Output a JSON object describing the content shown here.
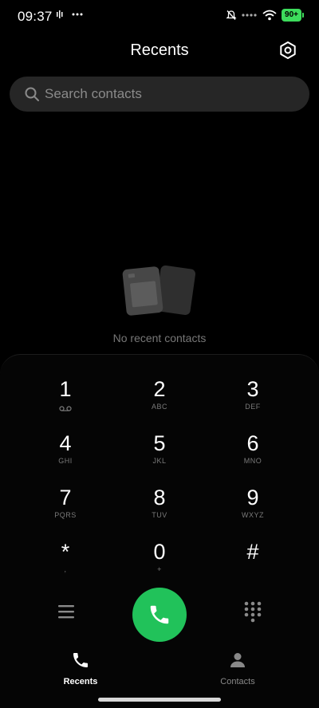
{
  "status_bar": {
    "time": "09:37",
    "battery": "90+"
  },
  "header": {
    "title": "Recents",
    "settings_icon": "settings-icon"
  },
  "search": {
    "placeholder": "Search contacts"
  },
  "empty_state": {
    "message": "No recent contacts"
  },
  "dialpad": {
    "keys": [
      {
        "digit": "1",
        "letters": ""
      },
      {
        "digit": "2",
        "letters": "ABC"
      },
      {
        "digit": "3",
        "letters": "DEF"
      },
      {
        "digit": "4",
        "letters": "GHI"
      },
      {
        "digit": "5",
        "letters": "JKL"
      },
      {
        "digit": "6",
        "letters": "MNO"
      },
      {
        "digit": "7",
        "letters": "PQRS"
      },
      {
        "digit": "8",
        "letters": "TUV"
      },
      {
        "digit": "9",
        "letters": "WXYZ"
      },
      {
        "digit": "*",
        "letters": ","
      },
      {
        "digit": "0",
        "letters": "+"
      },
      {
        "digit": "#",
        "letters": ""
      }
    ]
  },
  "bottom_nav": {
    "items": [
      {
        "label": "Recents",
        "icon": "phone-icon",
        "active": true
      },
      {
        "label": "Contacts",
        "icon": "person-icon",
        "active": false
      }
    ]
  },
  "colors": {
    "accent": "#21c25a",
    "background": "#000000",
    "battery": "#3ddc5c"
  }
}
